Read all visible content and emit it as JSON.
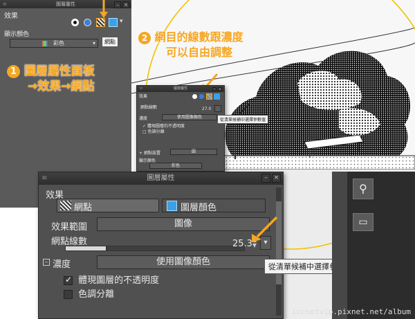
{
  "panel1": {
    "section_effect": "效果",
    "display_color_label": "顯示顏色",
    "display_color_value": "彩色",
    "tooltip": "網點"
  },
  "callout1": {
    "number": "1",
    "line1": "圖層屬性面板",
    "line2": "→效果→網點"
  },
  "callout2": {
    "number": "2",
    "line1": "網目的線數跟濃度",
    "line2": "可以自由調整"
  },
  "panel2": {
    "title": "圖層屬性",
    "section_effect": "效果",
    "line_count_label": "網點線數",
    "line_count_value": "27.0",
    "density_label": "濃度",
    "density_value": "使用圖像顏色",
    "reflect_opacity_label": "體現圖層的不透明度",
    "posterize_label": "色調分離",
    "halftone_settings_label": "網點設置",
    "halftone_settings_value": "圓",
    "display_color_label": "顯示顏色",
    "display_color_value": "彩色",
    "tooltip": "從清單候補中選擇參數值"
  },
  "panel3": {
    "title": "圖層屬性",
    "section_effect": "效果",
    "tab_halftone": "網點",
    "tab_layer_color": "圖層顏色",
    "effect_range_label": "效果範圍",
    "effect_range_value": "圖像",
    "line_count_label": "網點線數",
    "line_count_value": "25.3",
    "density_label": "濃度",
    "density_value": "使用圖像顏色",
    "reflect_opacity_label": "體現圖層的不透明度",
    "posterize_label": "色調分離",
    "tooltip": "從清單候補中選擇參數值"
  },
  "watermark": "iccnetvip.pixnet.net/album",
  "colors": {
    "callout_orange": "#f5a623",
    "panel_gray": "#505050",
    "layer_color_blue": "#3ba0e6"
  }
}
